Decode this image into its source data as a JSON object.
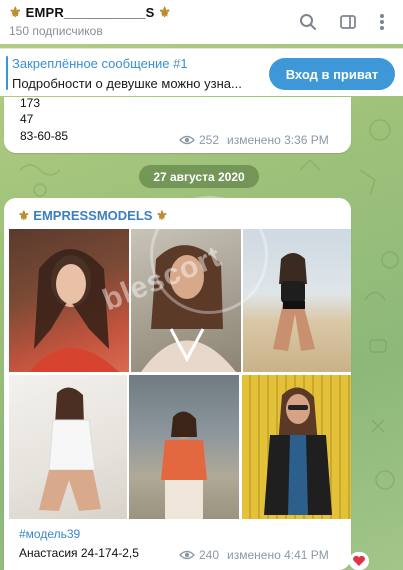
{
  "header": {
    "channel_title": "EMPR___________S",
    "subscribers": "150 подписчиков",
    "icons": [
      "search-icon",
      "sidebar-toggle-icon",
      "more-vertical-icon"
    ]
  },
  "pinned": {
    "title": "Закреплённое сообщение #1",
    "text": "Подробности о девушке можно узна...",
    "button_label": "Вход в приват"
  },
  "message_1": {
    "lines": [
      "173",
      "47",
      "83-60-85"
    ],
    "views": "252",
    "edited": "изменено 3:36 PM"
  },
  "date_separator": "27 августа 2020",
  "message_2": {
    "author": "EMPRESSMODELS",
    "photo_count": 6,
    "hashtag": "#модель39",
    "caption": "Анастасия 24-174-2,5",
    "views": "240",
    "edited": "изменено 4:41 PM",
    "reaction": "heart-icon"
  },
  "colors": {
    "accent": "#3e97d6",
    "link": "#3a86c8",
    "chat_bg": "#a3c58a",
    "reaction": "#e0334a"
  }
}
